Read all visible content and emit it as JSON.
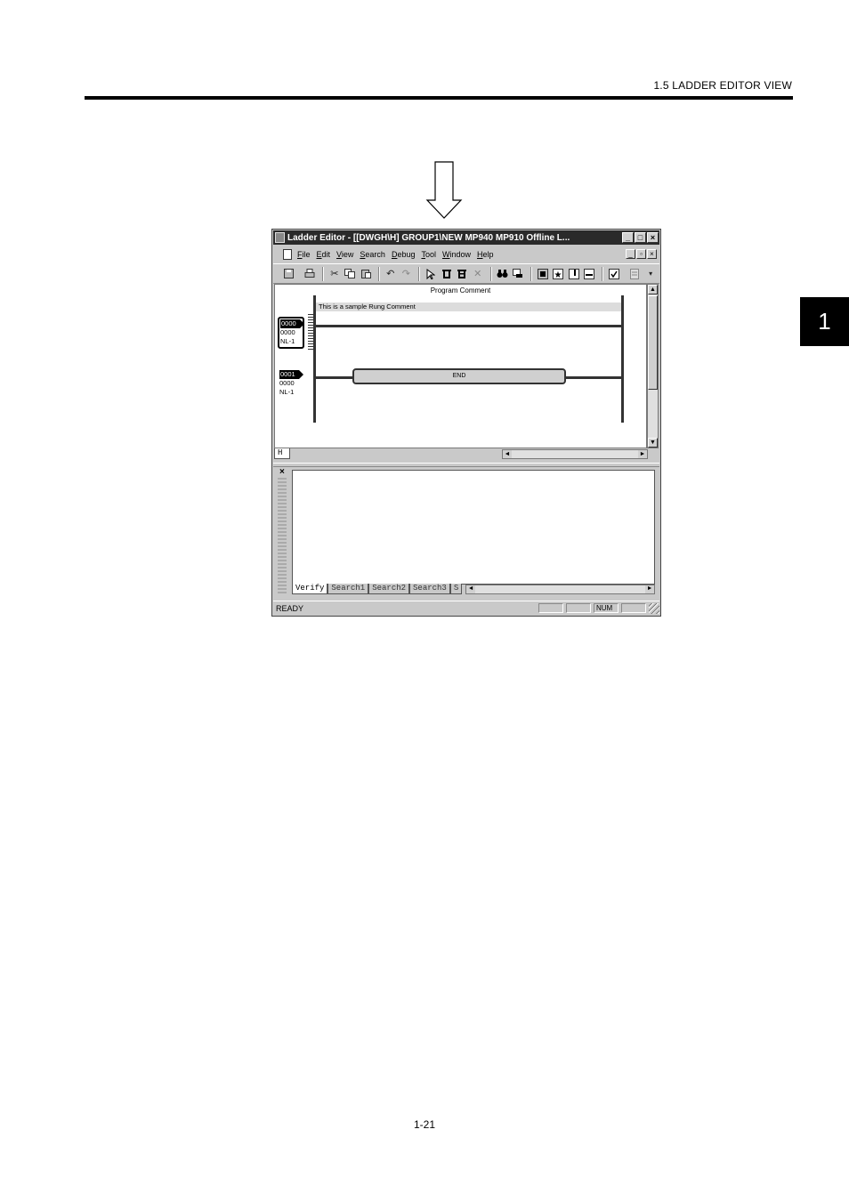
{
  "page": {
    "section_title": "1.5  LADDER EDITOR VIEW",
    "chapter_tab": "1",
    "page_number": "1-21"
  },
  "window": {
    "title": "Ladder Editor - [[DWGH\\H]   GROUP1\\NEW  MP940  MP910     Offline  L...",
    "title_buttons": [
      "_",
      "□",
      "×"
    ],
    "menu": [
      "File",
      "Edit",
      "View",
      "Search",
      "Debug",
      "Tool",
      "Window",
      "Help"
    ],
    "mdi_buttons": [
      "_",
      "▫",
      "×"
    ],
    "toolbar_icons": [
      "save-icon",
      "print-icon",
      "cut-icon",
      "copy-icon",
      "paste-icon",
      "undo-icon",
      "redo-icon",
      "select-icon",
      "insert-contact-icon",
      "insert-coil-icon",
      "delete-icon",
      "find-icon",
      "find-replace-icon",
      "monitor-icon",
      "favorite-icon",
      "window-icon",
      "collapse-icon",
      "check-icon",
      "doc-icon",
      "dropdown-icon"
    ]
  },
  "editor": {
    "program_comment": "Program Comment",
    "rung_comment": "This is a sample Rung Comment",
    "rungs": [
      {
        "number": "0000",
        "step": "0000",
        "nest": "NL-1"
      },
      {
        "number": "0001",
        "step": "0000",
        "nest": "NL-1"
      }
    ],
    "end_label": "END",
    "sheet_tab": "H"
  },
  "output": {
    "close": "×",
    "tabs": [
      "Verify",
      "Search1",
      "Search2",
      "Search3",
      "S"
    ]
  },
  "status": {
    "text": "READY",
    "cells": [
      "",
      "",
      "NUM",
      ""
    ]
  }
}
